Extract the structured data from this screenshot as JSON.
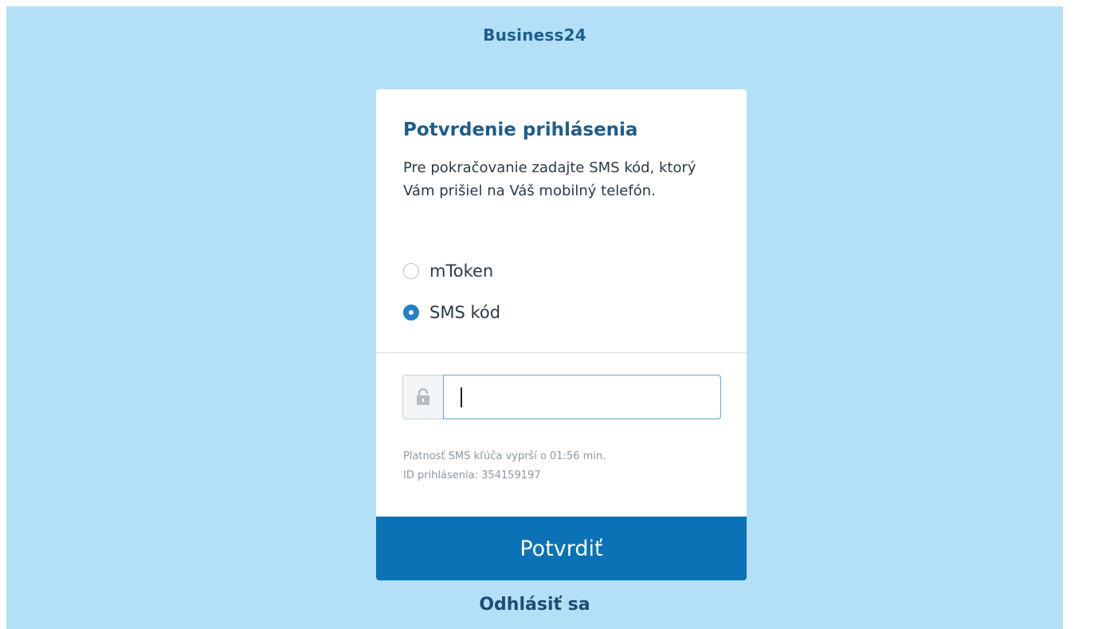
{
  "brand": {
    "title": "Business24"
  },
  "card": {
    "title": "Potvrdenie prihlásenia",
    "description": "Pre pokračovanie zadajte SMS kód, ktorý Vám prišiel na Váš mobilný telefón.",
    "options": [
      {
        "label": "mToken",
        "checked": false
      },
      {
        "label": "SMS kód",
        "checked": true
      }
    ],
    "input": {
      "value": "",
      "placeholder": "",
      "icon": "lock-icon"
    },
    "expiry_text": "Platnosť SMS kľúča vyprší o 01:56 min.",
    "login_id_text": "ID prihlásenia: 354159197",
    "submit_label": "Potvrdiť"
  },
  "logout_label": "Odhlásiť sa",
  "colors": {
    "background": "#b3e0f6",
    "accent": "#0b72b5",
    "heading": "#1d5d8e"
  }
}
